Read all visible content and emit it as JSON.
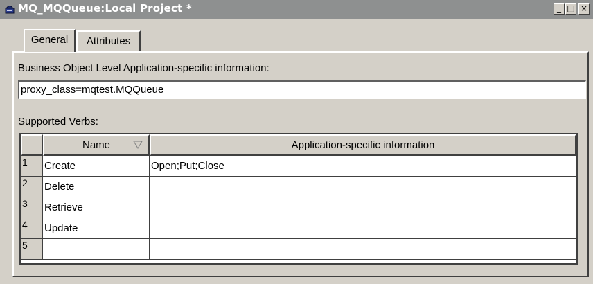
{
  "window": {
    "title": "MQ_MQQueue:Local Project *",
    "minimize_glyph": "_",
    "maximize_glyph": "□",
    "close_glyph": "×"
  },
  "tabs": [
    {
      "label": "General",
      "active": true
    },
    {
      "label": "Attributes",
      "active": false
    }
  ],
  "general": {
    "asi_label": "Business Object Level Application-specific information:",
    "asi_value": "proxy_class=mqtest.MQQueue",
    "verbs_label": "Supported Verbs:"
  },
  "verbs_table": {
    "columns": [
      "Name",
      "Application-specific information"
    ],
    "rows": [
      {
        "num": "1",
        "name": "Create",
        "asi": "Open;Put;Close"
      },
      {
        "num": "2",
        "name": "Delete",
        "asi": ""
      },
      {
        "num": "3",
        "name": "Retrieve",
        "asi": ""
      },
      {
        "num": "4",
        "name": "Update",
        "asi": ""
      },
      {
        "num": "5",
        "name": "",
        "asi": ""
      }
    ]
  },
  "icons": {
    "window": "business-object-icon",
    "sort": "sort-triangle-icon"
  }
}
